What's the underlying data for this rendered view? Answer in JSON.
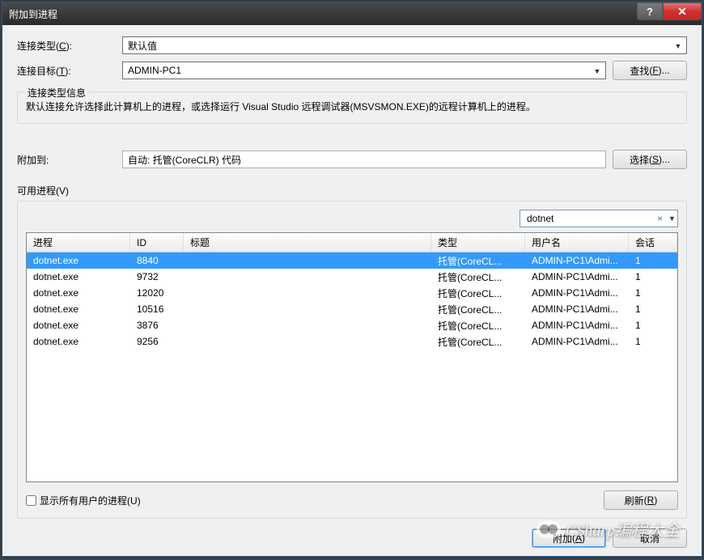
{
  "titlebar": {
    "title": "附加到进程"
  },
  "labels": {
    "connection_type": "连接类型",
    "connection_type_hotkey": "C",
    "connection_target": "连接目标",
    "connection_target_hotkey": "T",
    "find_button": "查找",
    "find_hotkey": "F",
    "group_title": "连接类型信息",
    "info_text": "默认连接允许选择此计算机上的进程，或选择运行 Visual Studio 远程调试器(MSVSMON.EXE)的远程计算机上的进程。",
    "attach_to": "附加到:",
    "select_button": "选择",
    "select_hotkey": "S",
    "available_processes": "可用进程",
    "available_processes_hotkey": "V",
    "show_all_users": "显示所有用户的进程",
    "show_all_users_hotkey": "U",
    "refresh_button": "刷新",
    "refresh_hotkey": "R",
    "attach_button": "附加",
    "attach_hotkey": "A",
    "cancel_button": "取消"
  },
  "values": {
    "connection_type": "默认值",
    "connection_target": "ADMIN-PC1",
    "attach_to": "自动: 托管(CoreCLR) 代码",
    "filter": "dotnet",
    "show_all_users_checked": false
  },
  "table": {
    "headers": {
      "process": "进程",
      "id": "ID",
      "title": "标题",
      "type": "类型",
      "user": "用户名",
      "session": "会话"
    },
    "rows": [
      {
        "process": "dotnet.exe",
        "id": "8840",
        "title": "",
        "type": "托管(CoreCL...",
        "user": "ADMIN-PC1\\Admi...",
        "session": "1",
        "selected": true
      },
      {
        "process": "dotnet.exe",
        "id": "9732",
        "title": "",
        "type": "托管(CoreCL...",
        "user": "ADMIN-PC1\\Admi...",
        "session": "1",
        "selected": false
      },
      {
        "process": "dotnet.exe",
        "id": "12020",
        "title": "",
        "type": "托管(CoreCL...",
        "user": "ADMIN-PC1\\Admi...",
        "session": "1",
        "selected": false
      },
      {
        "process": "dotnet.exe",
        "id": "10516",
        "title": "",
        "type": "托管(CoreCL...",
        "user": "ADMIN-PC1\\Admi...",
        "session": "1",
        "selected": false
      },
      {
        "process": "dotnet.exe",
        "id": "3876",
        "title": "",
        "type": "托管(CoreCL...",
        "user": "ADMIN-PC1\\Admi...",
        "session": "1",
        "selected": false
      },
      {
        "process": "dotnet.exe",
        "id": "9256",
        "title": "",
        "type": "托管(CoreCL...",
        "user": "ADMIN-PC1\\Admi...",
        "session": "1",
        "selected": false
      }
    ]
  },
  "watermark": "CSharp编程大全"
}
